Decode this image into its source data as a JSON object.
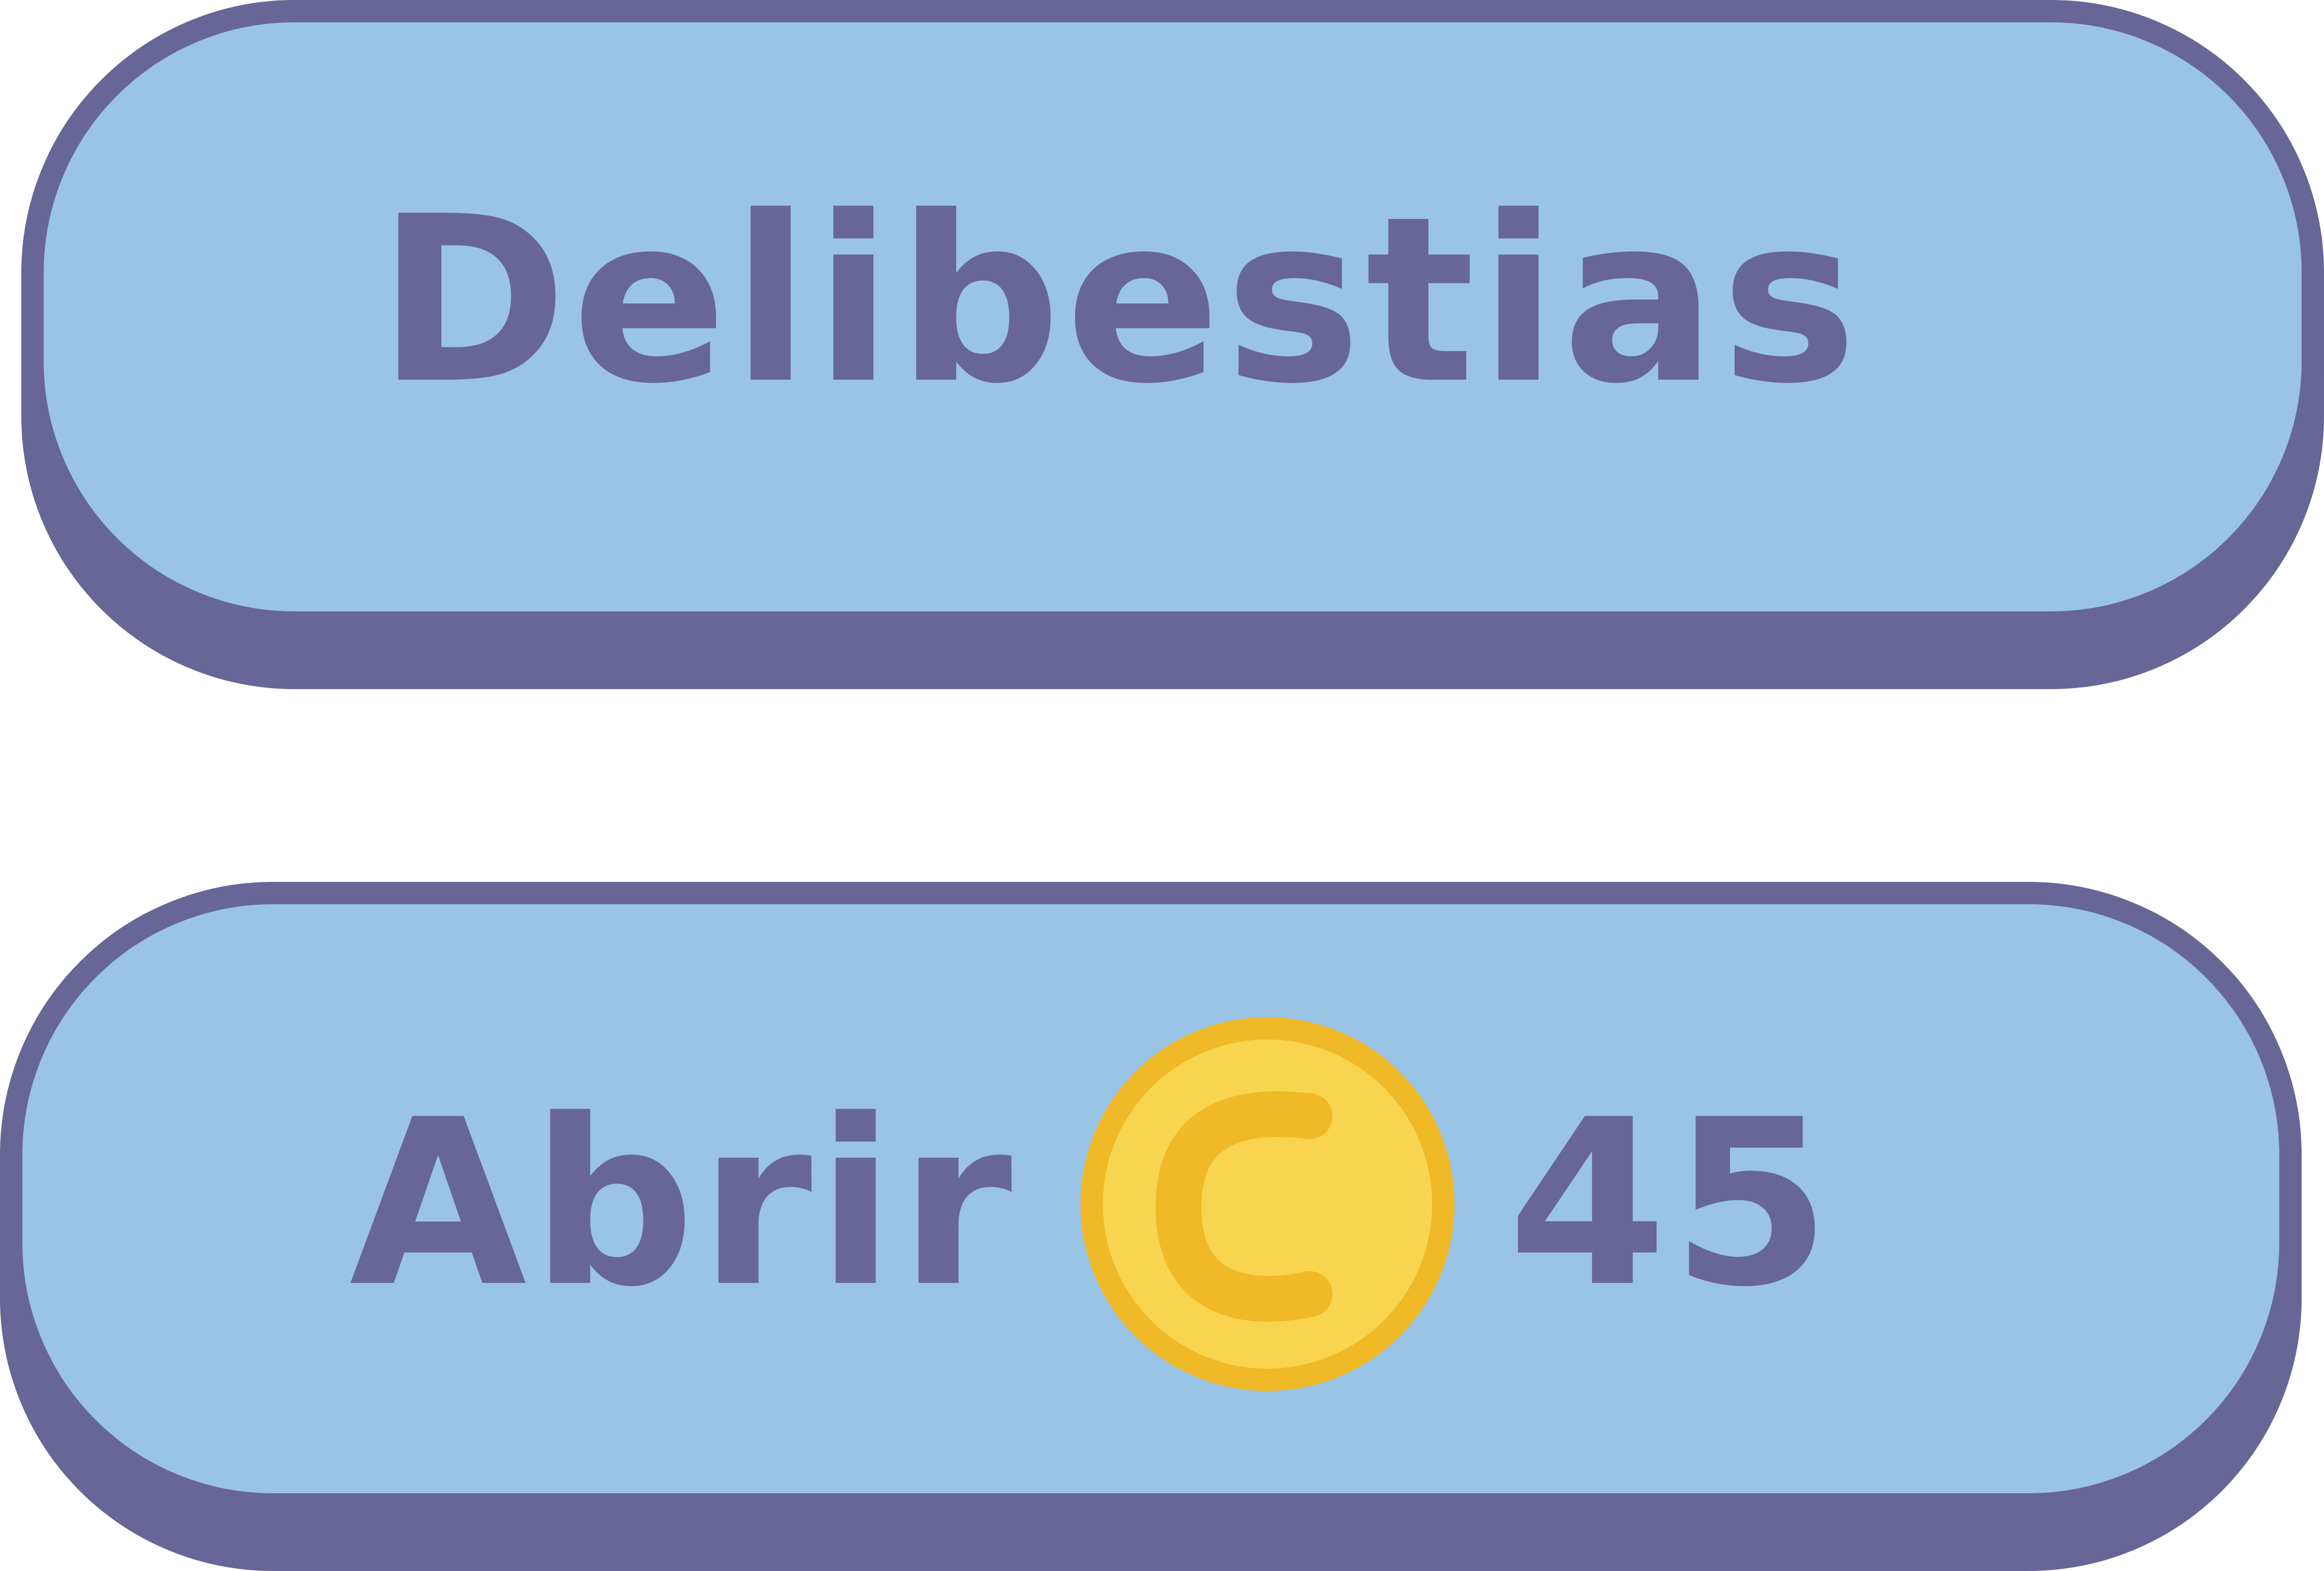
{
  "buttons": {
    "delibestias": {
      "label": "Delibestias"
    },
    "open": {
      "label": "Abrir",
      "coin_icon": "coin-c-icon",
      "price": "45"
    }
  },
  "colors": {
    "button_fill": "#9ac4e5",
    "button_border": "#676696",
    "text": "#676696",
    "coin_fill": "#f9d54f",
    "coin_ring": "#f0b928"
  }
}
